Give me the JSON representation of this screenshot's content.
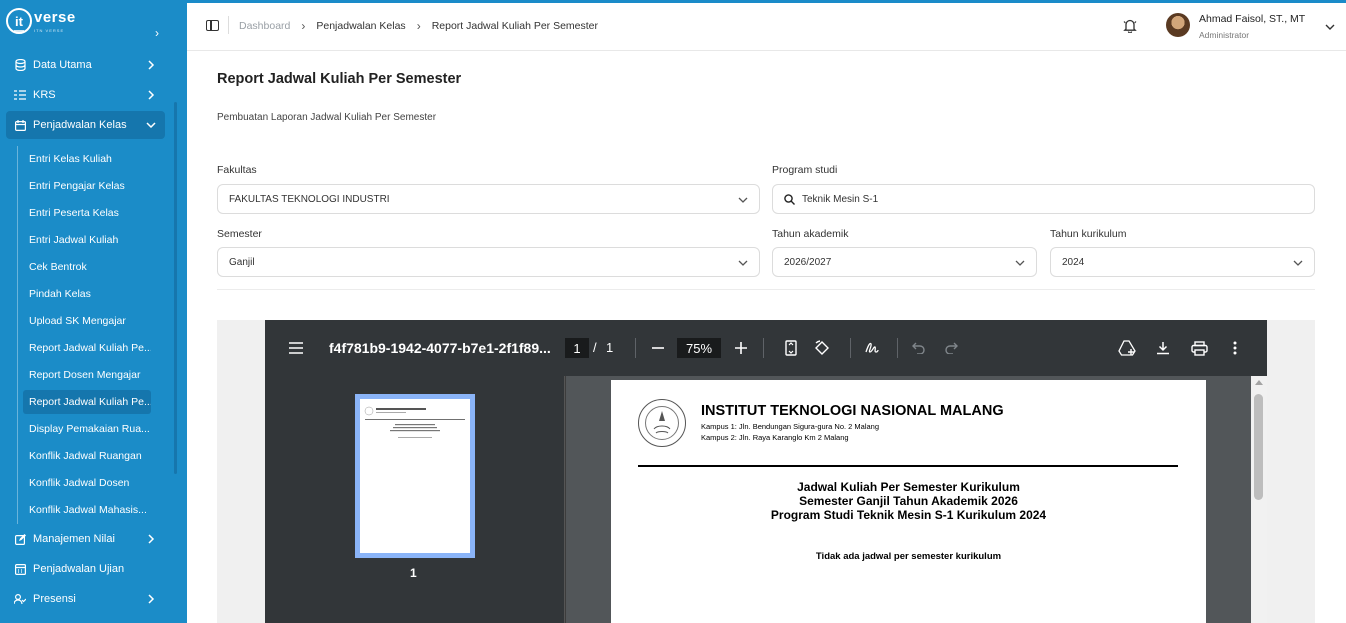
{
  "brand": {
    "logo_text": "verse",
    "logo_sub": "ITN VERSE",
    "logo_mark": "it"
  },
  "sidebar": {
    "items": [
      {
        "label": "Data Utama",
        "icon": "database-icon"
      },
      {
        "label": "KRS",
        "icon": "list-icon"
      },
      {
        "label": "Penjadwalan Kelas",
        "icon": "calendar-icon"
      },
      {
        "label": "Manajemen Nilai",
        "icon": "edit-icon"
      },
      {
        "label": "Penjadwalan Ujian",
        "icon": "calendar-grid-icon"
      },
      {
        "label": "Presensi",
        "icon": "user-check-icon"
      }
    ],
    "subitems": [
      "Entri Kelas Kuliah",
      "Entri Pengajar Kelas",
      "Entri Peserta Kelas",
      "Entri Jadwal Kuliah",
      "Cek Bentrok",
      "Pindah Kelas",
      "Upload SK Mengajar",
      "Report Jadwal Kuliah Pe...",
      "Report Dosen Mengajar",
      "Report Jadwal Kuliah Pe...",
      "Display Pemakaian Rua...",
      "Konflik Jadwal Ruangan",
      "Konflik Jadwal Dosen",
      "Konflik Jadwal Mahasis..."
    ]
  },
  "header": {
    "breadcrumb": [
      "Dashboard",
      "Penjadwalan Kelas",
      "Report Jadwal Kuliah Per Semester"
    ],
    "user_name": "Ahmad Faisol, ST., MT",
    "user_role": "Administrator"
  },
  "page": {
    "title": "Report Jadwal Kuliah Per Semester",
    "subtitle": "Pembuatan Laporan Jadwal Kuliah Per Semester"
  },
  "form": {
    "fakultas_label": "Fakultas",
    "fakultas_value": "FAKULTAS TEKNOLOGI INDUSTRI",
    "prodi_label": "Program studi",
    "prodi_value": "Teknik Mesin S-1",
    "semester_label": "Semester",
    "semester_value": "Ganjil",
    "tahun_akademik_label": "Tahun akademik",
    "tahun_akademik_value": "2026/2027",
    "tahun_kurikulum_label": "Tahun kurikulum",
    "tahun_kurikulum_value": "2024"
  },
  "pdf": {
    "filename": "f4f781b9-1942-4077-b7e1-2f1f89...",
    "page_current": "1",
    "page_sep": "/",
    "page_total": "1",
    "zoom": "75%",
    "thumb_label": "1",
    "doc": {
      "institution": "INSTITUT TEKNOLOGI NASIONAL MALANG",
      "campus1": "Kampus 1: Jln. Bendungan Sigura-gura No. 2 Malang",
      "campus2": "Kampus 2: Jln. Raya Karanglo Km 2 Malang",
      "line1": "Jadwal Kuliah Per Semester Kurikulum",
      "line2": "Semester Ganjil Tahun Akademik 2026",
      "line3": "Program Studi Teknik Mesin S-1 Kurikulum 2024",
      "empty": "Tidak ada jadwal per semester kurikulum"
    }
  },
  "colors": {
    "sidebar_bg": "#1b8cc8",
    "sidebar_active": "#1576ad",
    "pdf_toolbar": "#323639",
    "thumb_highlight": "#8ab4f8"
  }
}
